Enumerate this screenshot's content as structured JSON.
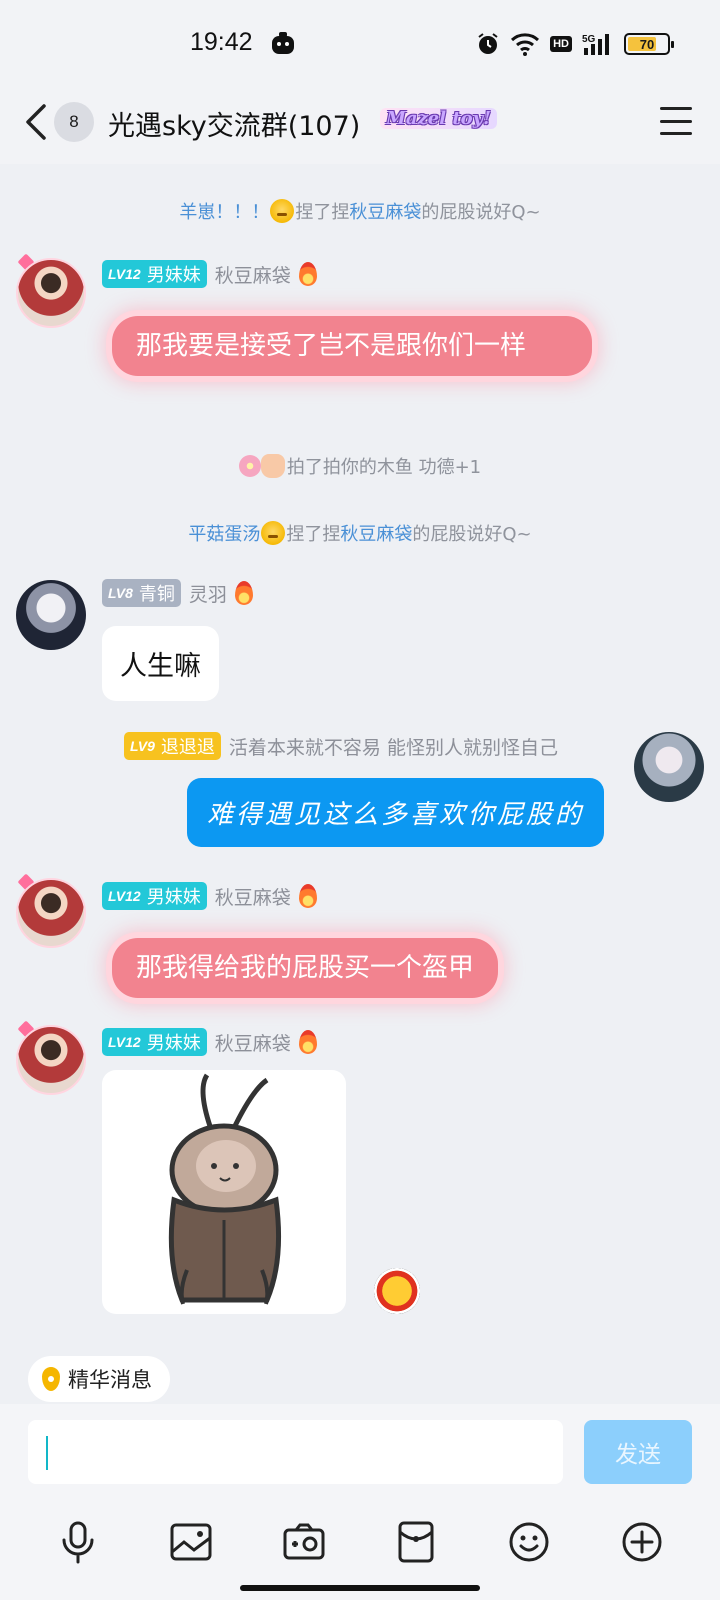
{
  "status_bar": {
    "time": "19:42",
    "battery": "70",
    "network": "5G",
    "hd": "HD"
  },
  "header": {
    "back_count": "8",
    "title": "光遇sky交流群(107)",
    "badge": "Mazel toy!"
  },
  "system_messages": [
    {
      "part1": "羊崽！！！",
      "part2": "捏了捏",
      "part3": "秋豆麻袋",
      "part4": "的屁股说好Q~"
    },
    {
      "text": "拍了拍你的木鱼 功德+1"
    },
    {
      "part1": "平菇蛋汤",
      "part2": "捏了捏",
      "part3": "秋豆麻袋",
      "part4": "的屁股说好Q~"
    }
  ],
  "messages": [
    {
      "level": "LV12",
      "rank": "男妹妹",
      "nick": "秋豆麻袋",
      "text": "那我要是接受了岂不是跟你们一样"
    },
    {
      "level": "LV8",
      "rank": "青铜",
      "nick": "灵羽",
      "text": "人生嘛"
    },
    {
      "level": "LV9",
      "rank": "退退退",
      "title": "活着本来就不容易 能怪别人就别怪自己",
      "text": "难得遇见这么多喜欢你屁股的"
    },
    {
      "level": "LV12",
      "rank": "男妹妹",
      "nick": "秋豆麻袋",
      "text": "那我得给我的屁股买一个盔甲"
    },
    {
      "level": "LV12",
      "rank": "男妹妹",
      "nick": "秋豆麻袋",
      "sticker": "cockroach-sticker"
    }
  ],
  "essence_label": "精华消息",
  "input": {
    "value": "",
    "send_label": "发送"
  },
  "toolbar_icons": [
    "microphone-icon",
    "image-icon",
    "camera-icon",
    "red-packet-icon",
    "emoji-icon",
    "plus-icon"
  ],
  "colors": {
    "accent": "#0c98f2",
    "pink_bubble": "#f2838f",
    "teal_badge": "#23c8d8",
    "gold_badge": "#f7c21f",
    "link": "#4a90d6"
  }
}
